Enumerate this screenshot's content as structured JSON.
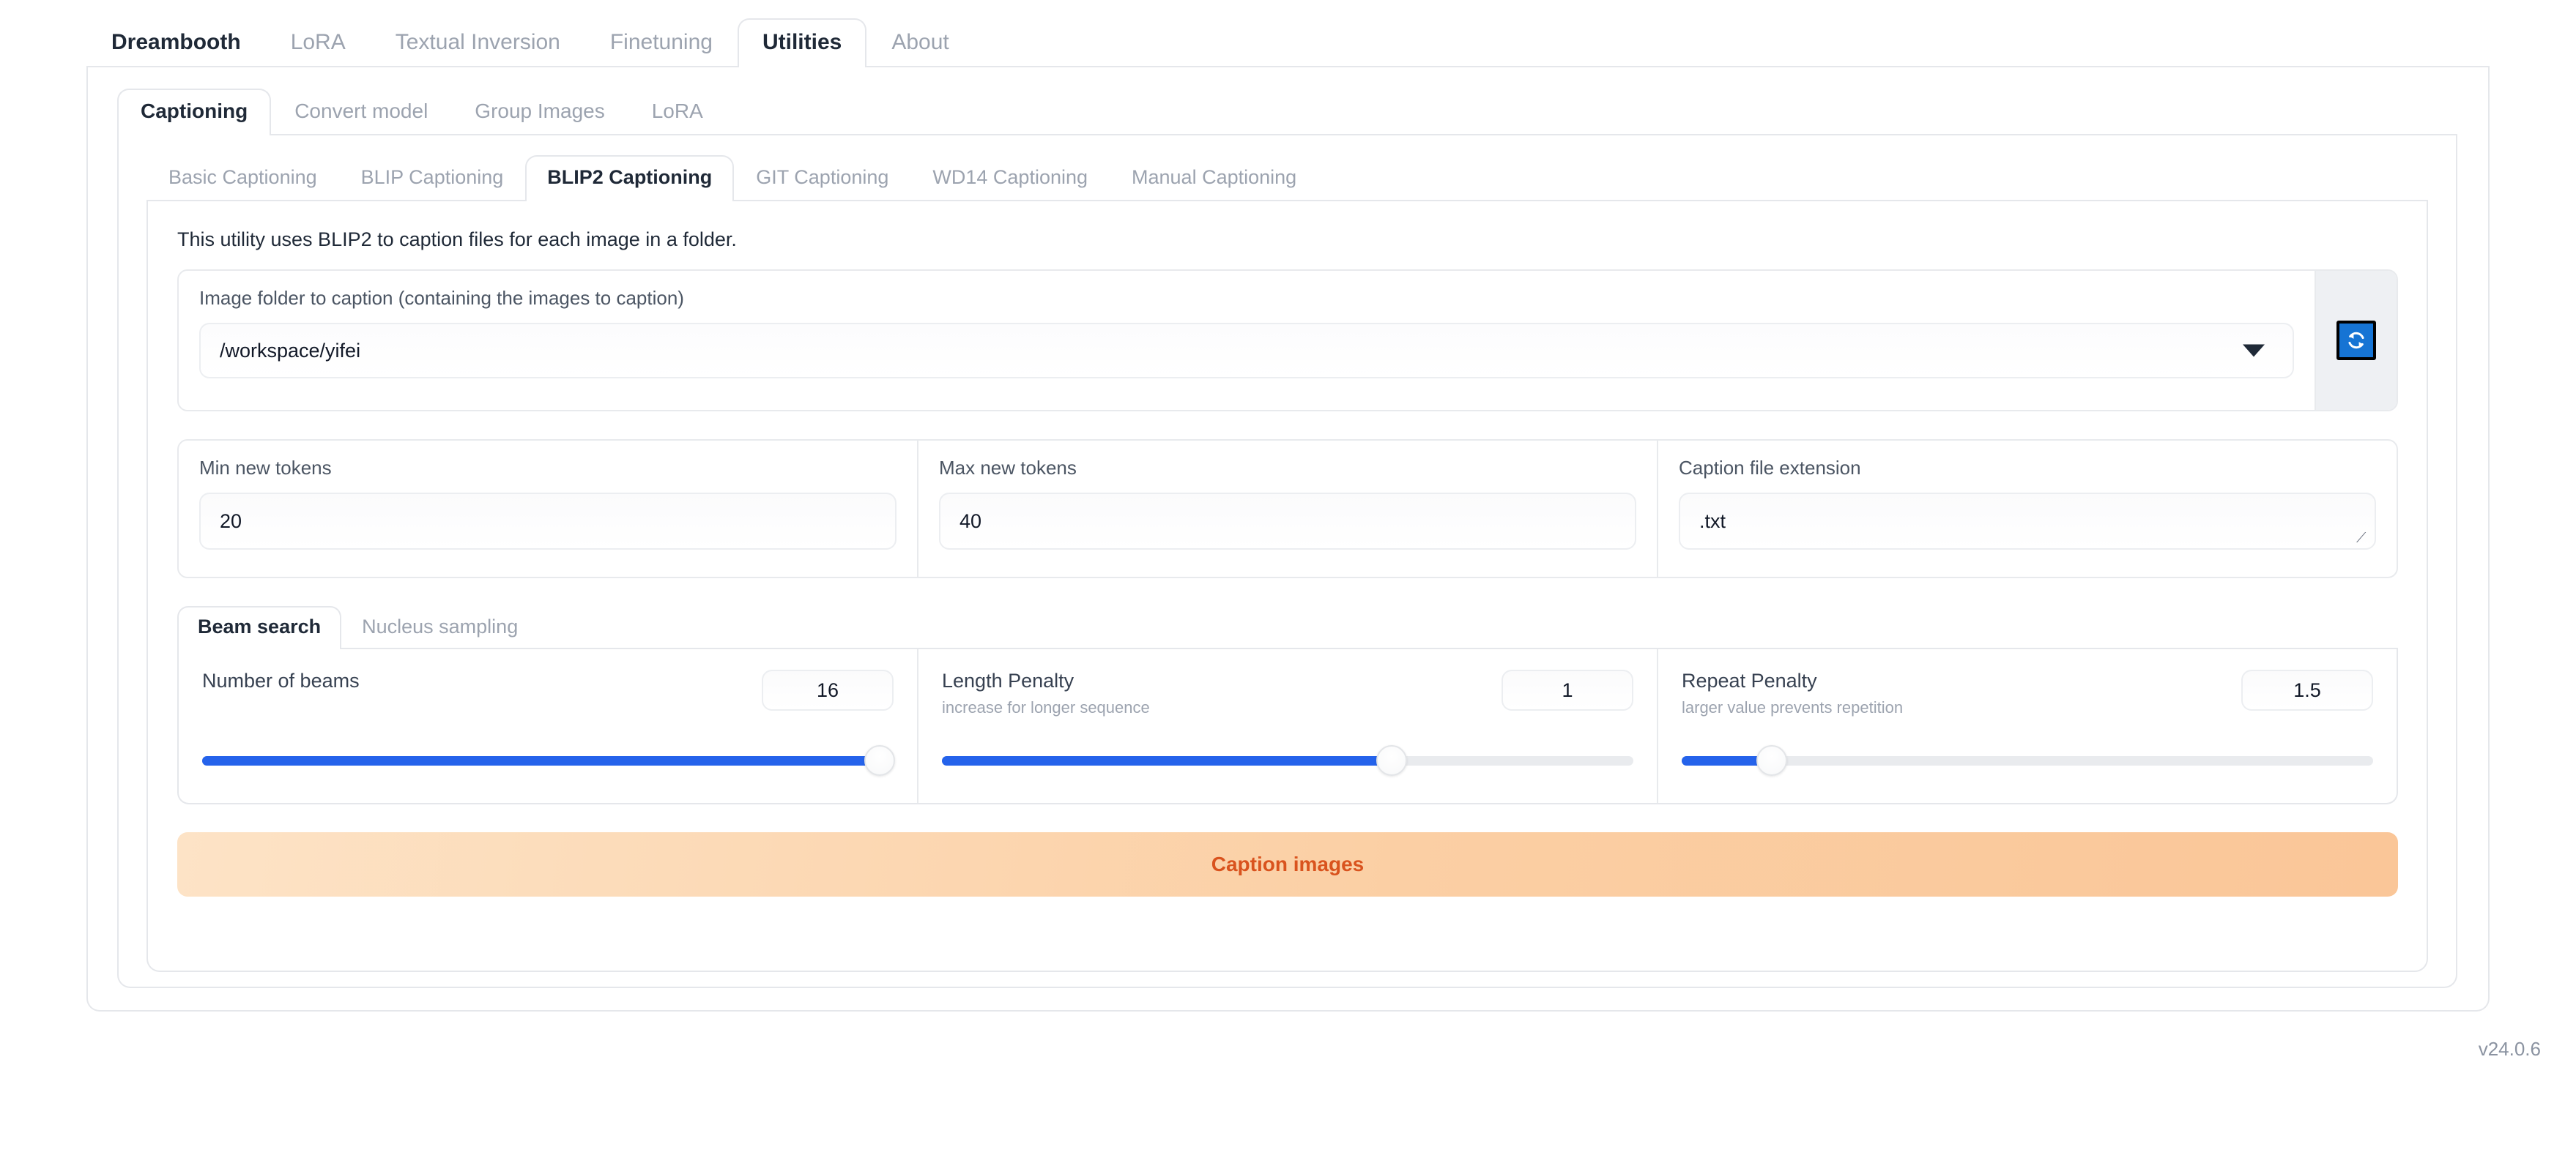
{
  "app": {
    "version_label": "v24.0.6"
  },
  "primary_tabs": [
    {
      "label": "Dreambooth",
      "state": "selected-text"
    },
    {
      "label": "LoRA",
      "state": "inactive"
    },
    {
      "label": "Textual Inversion",
      "state": "inactive"
    },
    {
      "label": "Finetuning",
      "state": "inactive"
    },
    {
      "label": "Utilities",
      "state": "active"
    },
    {
      "label": "About",
      "state": "inactive"
    }
  ],
  "secondary_tabs": [
    {
      "label": "Captioning",
      "state": "active"
    },
    {
      "label": "Convert model",
      "state": "inactive"
    },
    {
      "label": "Group Images",
      "state": "inactive"
    },
    {
      "label": "LoRA",
      "state": "inactive"
    }
  ],
  "captioning_tabs": [
    {
      "label": "Basic Captioning",
      "state": "inactive"
    },
    {
      "label": "BLIP Captioning",
      "state": "inactive"
    },
    {
      "label": "BLIP2 Captioning",
      "state": "active"
    },
    {
      "label": "GIT Captioning",
      "state": "inactive"
    },
    {
      "label": "WD14 Captioning",
      "state": "inactive"
    },
    {
      "label": "Manual Captioning",
      "state": "inactive"
    }
  ],
  "content": {
    "description": "This utility uses BLIP2 to caption files for each image in a folder.",
    "folder": {
      "label": "Image folder to caption (containing the images to caption)",
      "value": "/workspace/yifei",
      "refresh_icon": "refresh-icon"
    },
    "fields": [
      {
        "label": "Min new tokens",
        "value": "20",
        "name": "min-new-tokens"
      },
      {
        "label": "Max new tokens",
        "value": "40",
        "name": "max-new-tokens"
      },
      {
        "label": "Caption file extension",
        "value": ".txt",
        "name": "caption-file-extension"
      }
    ],
    "sampling_tabs": [
      {
        "label": "Beam search",
        "state": "active"
      },
      {
        "label": "Nucleus sampling",
        "state": "inactive"
      }
    ],
    "sliders": [
      {
        "name": "number-of-beams",
        "title": "Number of beams",
        "hint": "",
        "value": "16",
        "fill_percent": 98
      },
      {
        "name": "length-penalty",
        "title": "Length Penalty",
        "hint": "increase for longer sequence",
        "value": "1",
        "fill_percent": 65
      },
      {
        "name": "repeat-penalty",
        "title": "Repeat Penalty",
        "hint": "larger value prevents repetition",
        "value": "1.5",
        "fill_percent": 13
      }
    ],
    "caption_button_label": "Caption images"
  },
  "colors": {
    "accent_blue": "#2563eb",
    "refresh_blue": "#1674d4",
    "button_orange_text": "#d9531e",
    "border_gray": "#e5e7eb"
  }
}
